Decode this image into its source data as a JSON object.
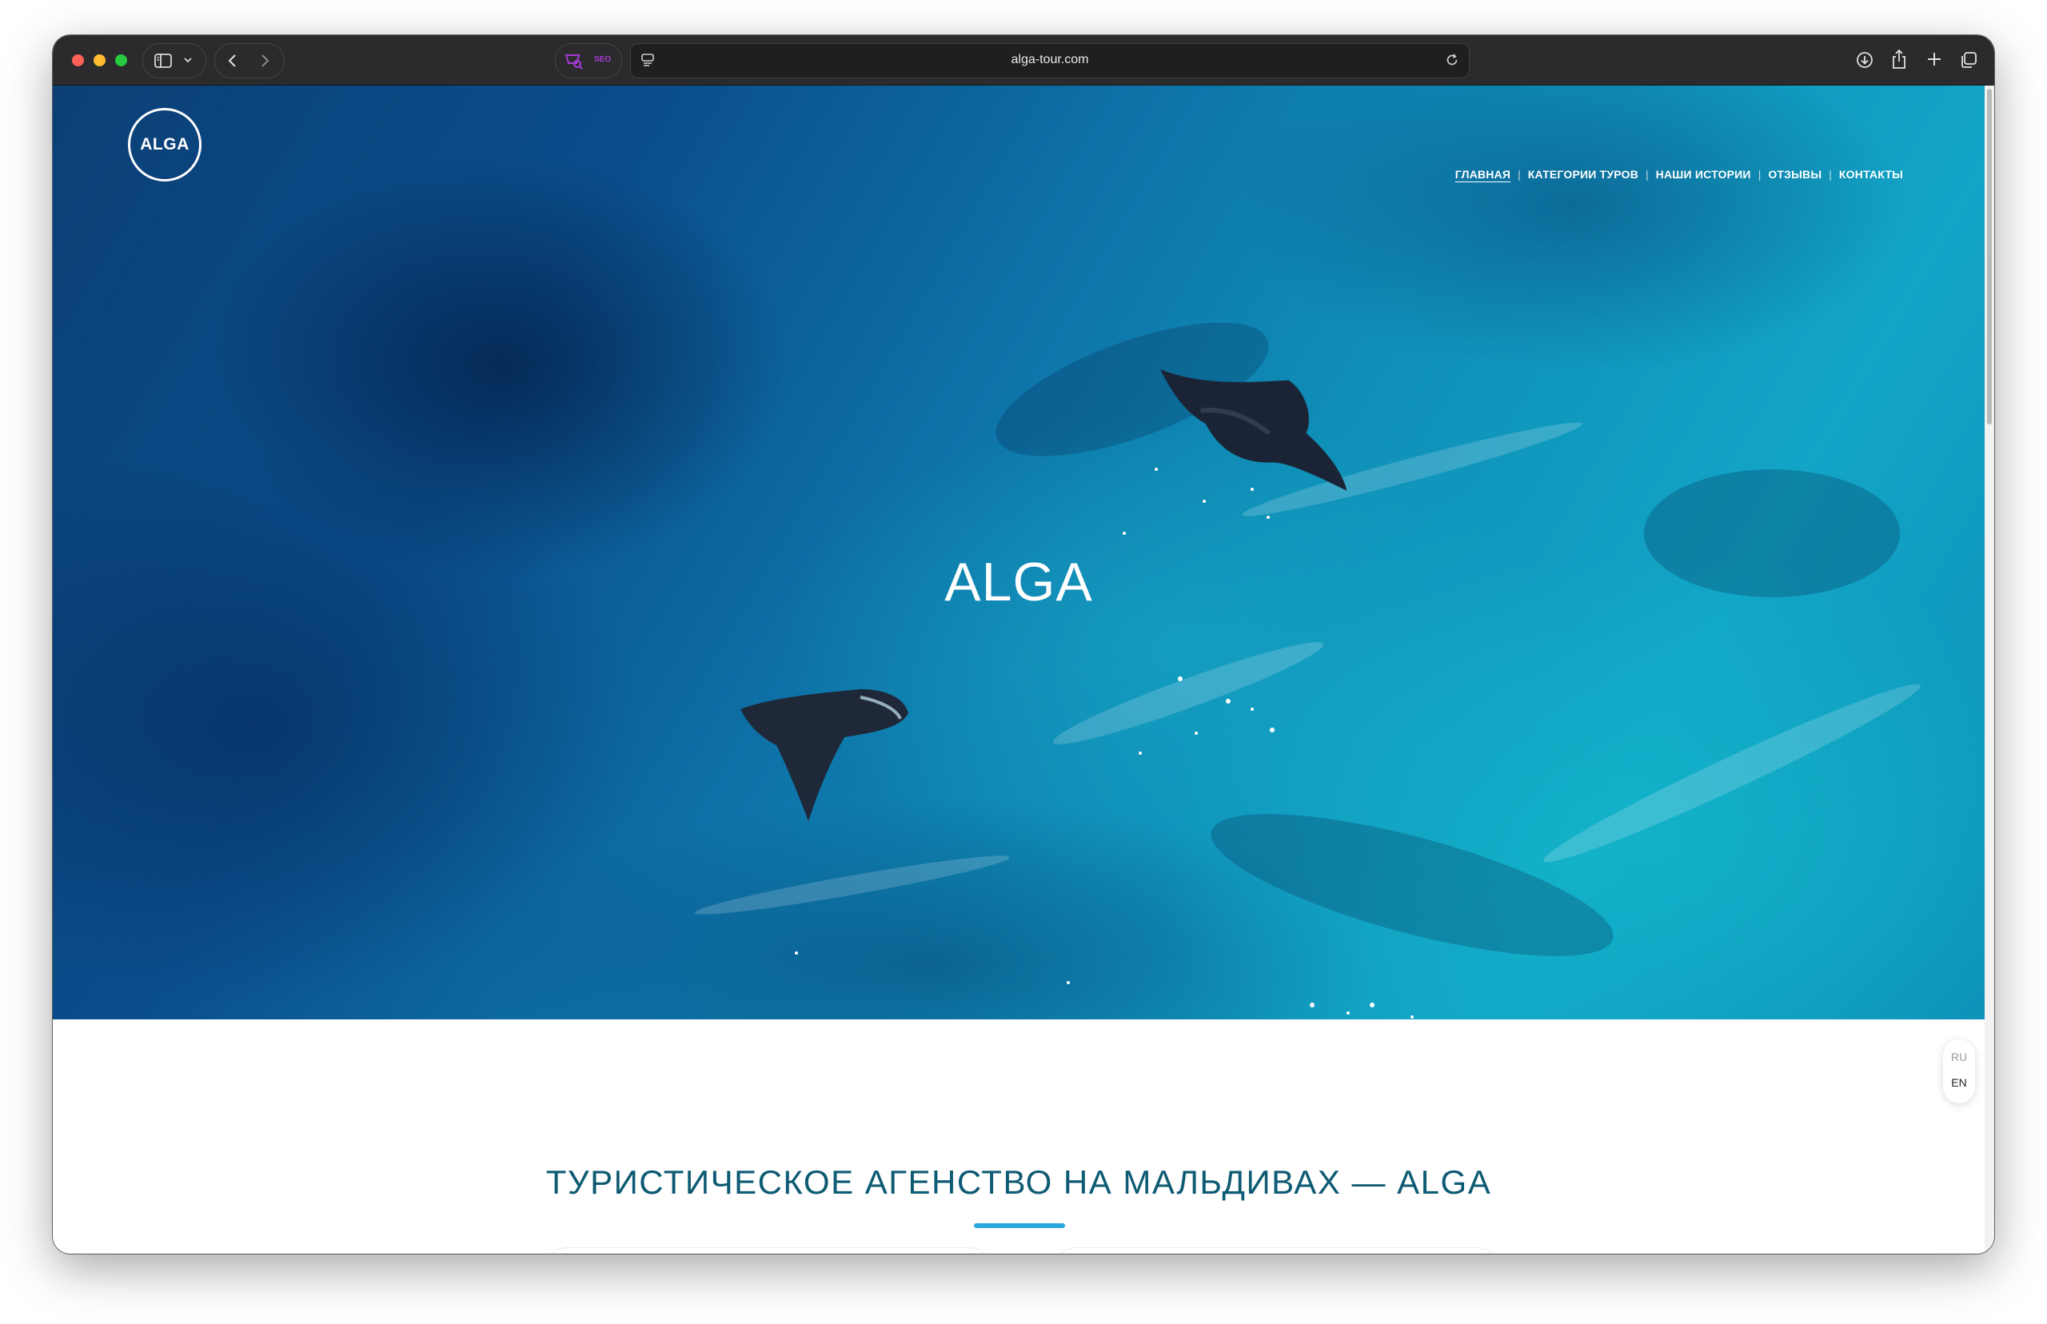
{
  "browser": {
    "url": "alga-tour.com",
    "seo_badge": "SEO",
    "icons": [
      "sidebar-icon",
      "chevron-down-icon",
      "back-icon",
      "forward-icon",
      "extension-icon",
      "page-settings-icon",
      "reload-icon",
      "download-icon",
      "share-icon",
      "new-tab-icon",
      "tabs-overview-icon"
    ]
  },
  "site": {
    "logo_text": "ALGA",
    "nav": [
      {
        "label": "ГЛАВНАЯ",
        "active": true
      },
      {
        "label": "КАТЕГОРИИ ТУРОВ",
        "active": false
      },
      {
        "label": "НАШИ ИСТОРИИ",
        "active": false
      },
      {
        "label": "ОТЗЫВЫ",
        "active": false
      },
      {
        "label": "КОНТАКТЫ",
        "active": false
      }
    ],
    "nav_separator": "|",
    "hero_title": "ALGA",
    "section_title": "ТУРИСТИЧЕСКОЕ АГЕНСТВО НА МАЛЬДИВАХ — ALGA",
    "languages": {
      "ru": "RU",
      "en": "EN",
      "selected": "EN"
    }
  },
  "colors": {
    "toolbar": "#2b2b2d",
    "section_title": "#0d5a73",
    "accent_bar": "#29a8e0",
    "seo_badge": "#a63ad6"
  }
}
